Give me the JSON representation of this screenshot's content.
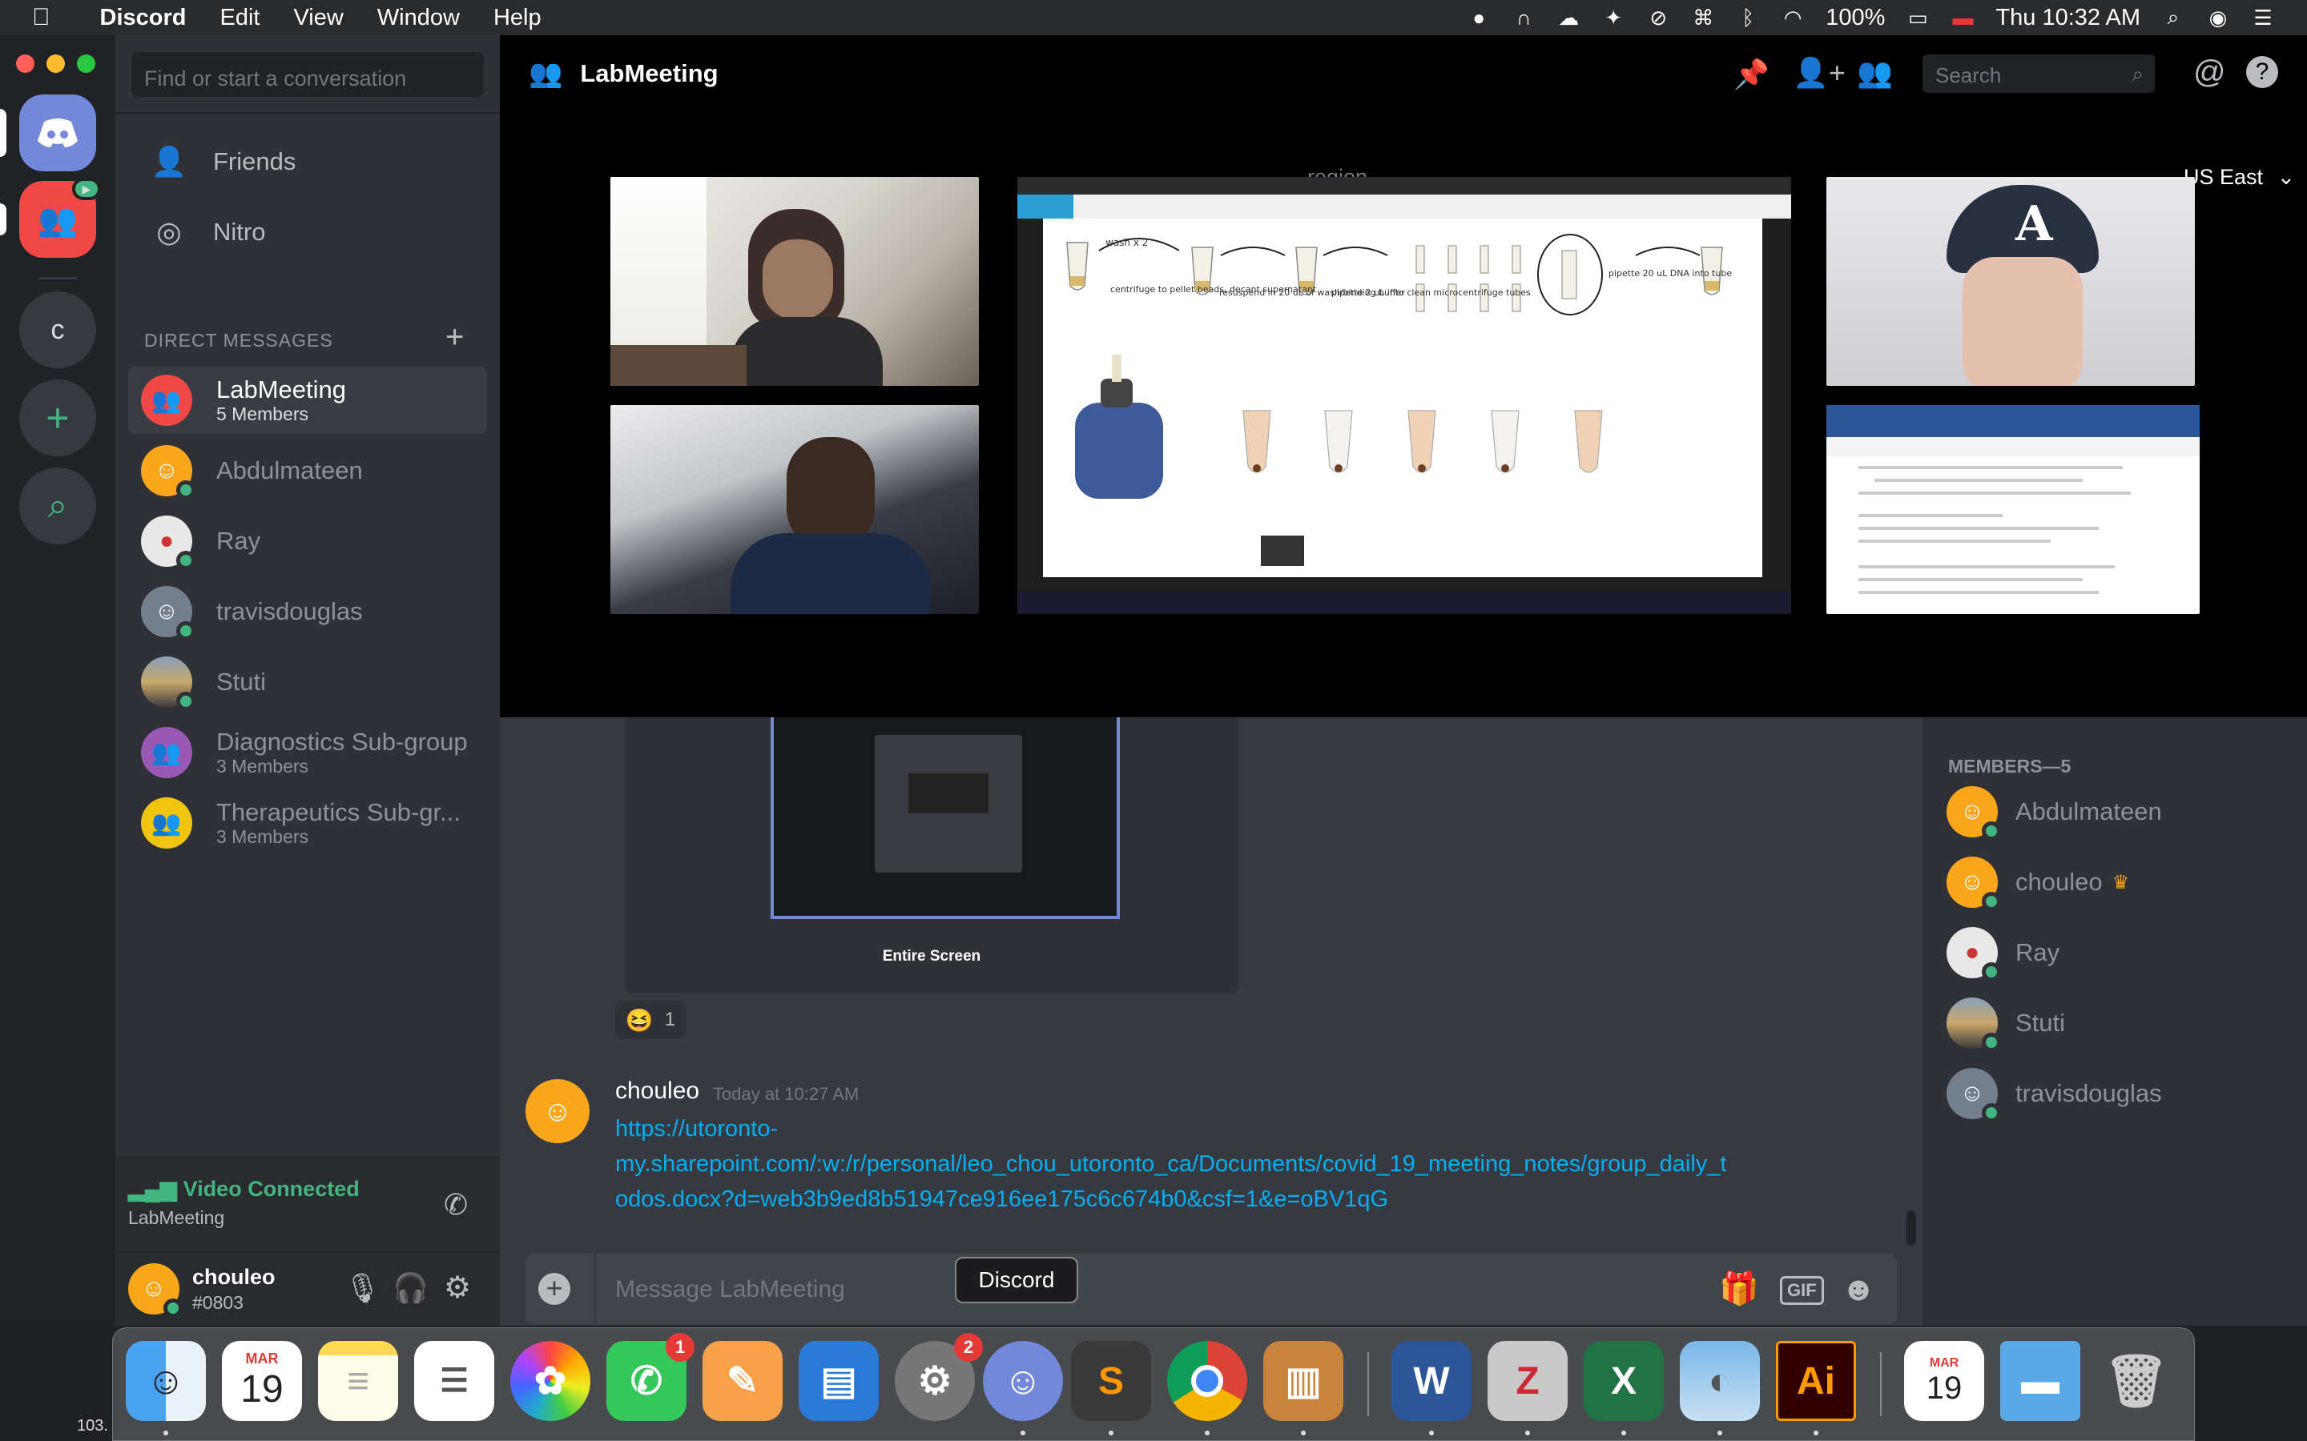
{
  "menubar": {
    "app": "Discord",
    "menus": [
      "Edit",
      "View",
      "Window",
      "Help"
    ],
    "battery": "100%",
    "clock": "Thu 10:32 AM"
  },
  "channels": {
    "search_placeholder": "Find or start a conversation",
    "nav": [
      "Friends",
      "Nitro"
    ],
    "dm_header": "DIRECT MESSAGES",
    "dms": [
      {
        "name": "LabMeeting",
        "sub": "5 Members"
      },
      {
        "name": "Abdulmateen",
        "sub": ""
      },
      {
        "name": "Ray",
        "sub": ""
      },
      {
        "name": "travisdouglas",
        "sub": ""
      },
      {
        "name": "Stuti",
        "sub": ""
      },
      {
        "name": "Diagnostics Sub-group",
        "sub": "3 Members"
      },
      {
        "name": "Therapeutics Sub-gr...",
        "sub": "3 Members"
      }
    ],
    "guild_letter": "c",
    "voice_status": "Video Connected",
    "voice_channel": "LabMeeting",
    "user_name": "chouleo",
    "user_tag": "#0803"
  },
  "topbar": {
    "title": "LabMeeting",
    "search_placeholder": "Search",
    "region_label": "region",
    "region_value": "US East"
  },
  "stage": {
    "screen_labels": [
      "wash x 2",
      "centrifuge to pellet beads, decant supernatant",
      "resuspend in 20 uL of wash/binding buffer",
      "pipette 2 uL into clean microcentrifuge tubes",
      "pipette 20 uL DNA into tube"
    ]
  },
  "chat": {
    "share_caption": "Entire Screen",
    "reaction_count": "1",
    "message": {
      "author": "chouleo",
      "timestamp": "Today at 10:27 AM",
      "link_line1": "https://utoronto-",
      "link_line2": "my.sharepoint.com/:w:/r/personal/leo_chou_utoronto_ca/Documents/covid_19_meeting_notes/group_daily_t",
      "link_line3": "odos.docx?d=web3b9ed8b51947ce916ee175c6c674b0&csf=1&e=oBV1qG"
    },
    "input_placeholder": "Message LabMeeting",
    "gif_label": "GIF"
  },
  "members": {
    "header": "MEMBERS—5",
    "list": [
      "Abdulmateen",
      "chouleo",
      "Ray",
      "Stuti",
      "travisdouglas"
    ]
  },
  "dock": {
    "tooltip": "Discord",
    "calendar_month": "MAR",
    "calendar_day": "19",
    "facetime_badge": "1",
    "prefs_badge": "2",
    "illustrator_label": "Ai",
    "corner_text": "103."
  },
  "colors": {
    "blurple": "#7289da",
    "online": "#43b581",
    "link": "#00b0f4",
    "group_red": "#f04747"
  }
}
